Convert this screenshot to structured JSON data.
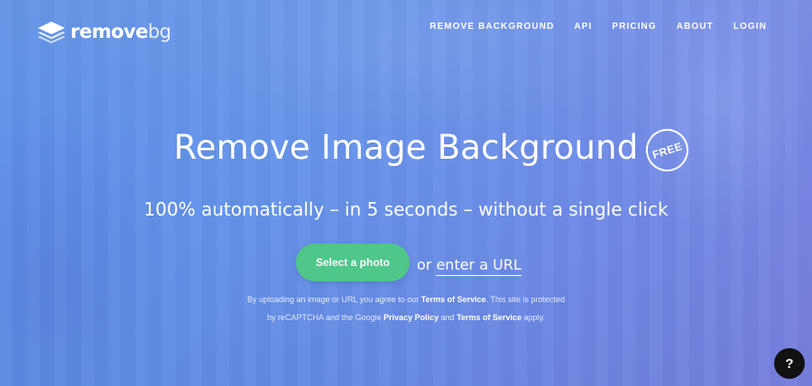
{
  "header": {
    "logo": {
      "text_main": "remove",
      "text_suffix": "bg",
      "icon": "layers-icon"
    },
    "nav": [
      {
        "label": "REMOVE BACKGROUND"
      },
      {
        "label": "API"
      },
      {
        "label": "PRICING"
      },
      {
        "label": "ABOUT"
      },
      {
        "label": "LOGIN"
      }
    ]
  },
  "hero": {
    "title": "Remove Image Background",
    "badge": "FREE",
    "subtitle": "100% automatically – in 5 seconds – without a single click",
    "select_button": "Select a photo",
    "or_text": "or ",
    "url_link": "enter a URL"
  },
  "legal": {
    "line1_prefix": "By uploading an image or URL you agree to our ",
    "terms1": "Terms of Service",
    "line1_suffix": ". This site is protected",
    "line2_prefix": "by reCAPTCHA and the Google ",
    "privacy": "Privacy Policy",
    "line2_mid": " and ",
    "terms2": "Terms of Service",
    "line2_suffix": " apply."
  },
  "help": {
    "label": "?"
  },
  "colors": {
    "accent_green": "#4fc68a",
    "background_blue": "#6594ea",
    "help_button": "#111111"
  }
}
